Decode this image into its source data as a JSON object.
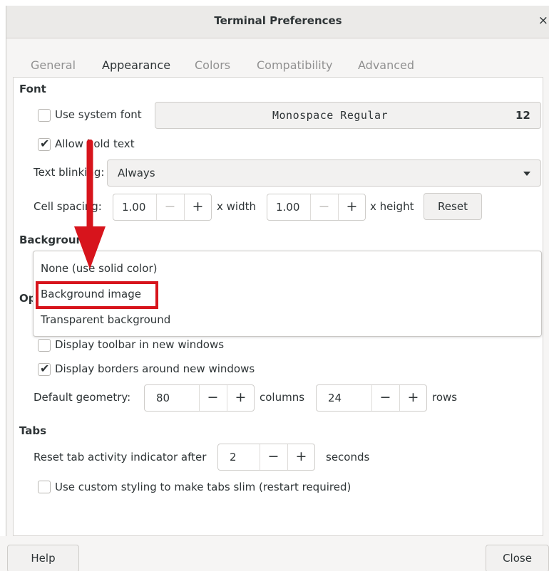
{
  "window": {
    "title": "Terminal Preferences",
    "close_glyph": "×"
  },
  "tabs": [
    {
      "label": "General",
      "active": false
    },
    {
      "label": "Appearance",
      "active": true
    },
    {
      "label": "Colors",
      "active": false
    },
    {
      "label": "Compatibility",
      "active": false
    },
    {
      "label": "Advanced",
      "active": false
    }
  ],
  "font": {
    "section": "Font",
    "use_system_font": {
      "label": "Use system font",
      "checked": false
    },
    "font_button": {
      "name": "Monospace Regular",
      "size": "12"
    },
    "allow_bold": {
      "label": "Allow bold text",
      "checked": true
    },
    "text_blink": {
      "label": "Text blinking:",
      "value": "Always"
    },
    "cell_spacing": {
      "label": "Cell spacing:",
      "width_value": "1.00",
      "width_unit": "x width",
      "height_value": "1.00",
      "height_unit": "x height",
      "reset_label": "Reset"
    }
  },
  "background": {
    "section": "Background",
    "options": [
      "None (use solid color)",
      "Background image",
      "Transparent background"
    ],
    "highlighted_option": "Background image"
  },
  "options": {
    "section": "Options",
    "toolbar": {
      "label": "Display toolbar in new windows",
      "checked": false
    },
    "borders": {
      "label": "Display borders around new windows",
      "checked": true
    },
    "geometry": {
      "label": "Default geometry:",
      "columns_value": "80",
      "columns_unit": "columns",
      "rows_value": "24",
      "rows_unit": "rows"
    }
  },
  "tabs_section": {
    "section": "Tabs",
    "reset_activity": {
      "label": "Reset tab activity indicator after",
      "value": "2",
      "unit": "seconds"
    },
    "slim_tabs": {
      "label": "Use custom styling to make tabs slim (restart required)",
      "checked": false
    }
  },
  "footer": {
    "help_label": "Help",
    "close_label": "Close"
  },
  "glyphs": {
    "check": "✔",
    "minus": "−",
    "plus": "+"
  },
  "annotation": {
    "color": "#d7141c"
  },
  "colors": {
    "accent": "#3584e4"
  }
}
